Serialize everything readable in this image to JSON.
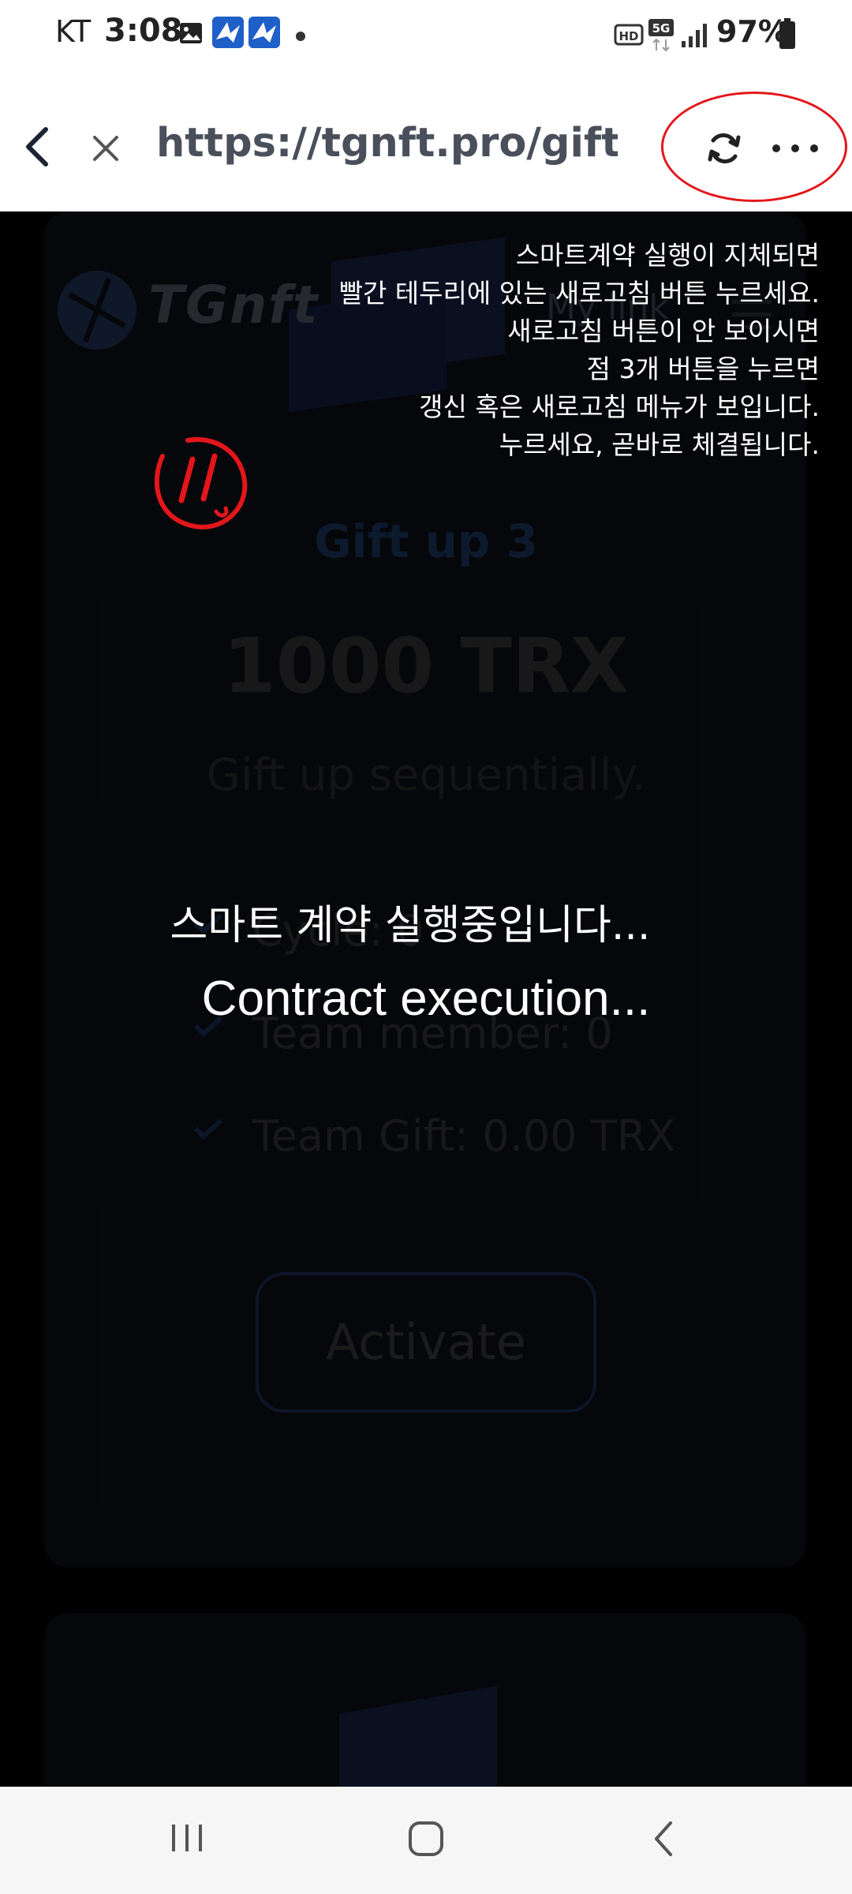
{
  "status_bar": {
    "carrier": "KT",
    "time": "3:08",
    "battery": "97%",
    "icons": [
      "image-icon",
      "app-notification-icon",
      "app-notification-icon",
      "dot-icon",
      "hd-voice-icon",
      "5g-icon",
      "signal-icon",
      "battery-icon"
    ]
  },
  "browser": {
    "url": "https://tgnft.pro/giftup.…",
    "icons": [
      "back-icon",
      "close-icon",
      "refresh-icon",
      "more-icon"
    ]
  },
  "page": {
    "logo": "TGnft",
    "my_link": "My link",
    "gift_title": "Gift up 3",
    "amount": "1000 TRX",
    "subtitle": "Gift up sequentially.",
    "features": [
      "Cycle: 0",
      "Team member: 0",
      "Team Gift: 0.00 TRX"
    ],
    "activate_label": "Activate"
  },
  "notice": {
    "lines": [
      "스마트계약 실행이 지체되면",
      "빨간 테두리에 있는 새로고침 버튼 누르세요.",
      "새로고침 버튼이 안 보이시면",
      "점 3개 버튼을 누르면",
      "갱신 혹은 새로고침 메뉴가 보입니다.",
      "누르세요,  곧바로 체결됩니다."
    ]
  },
  "overlay": {
    "exec_kr": "스마트 계약 실행중입니다...",
    "exec_en": "Contract execution..."
  },
  "colors": {
    "highlight": "#e3161b",
    "title_blue": "#142744",
    "overlay_bg": "#000000"
  }
}
